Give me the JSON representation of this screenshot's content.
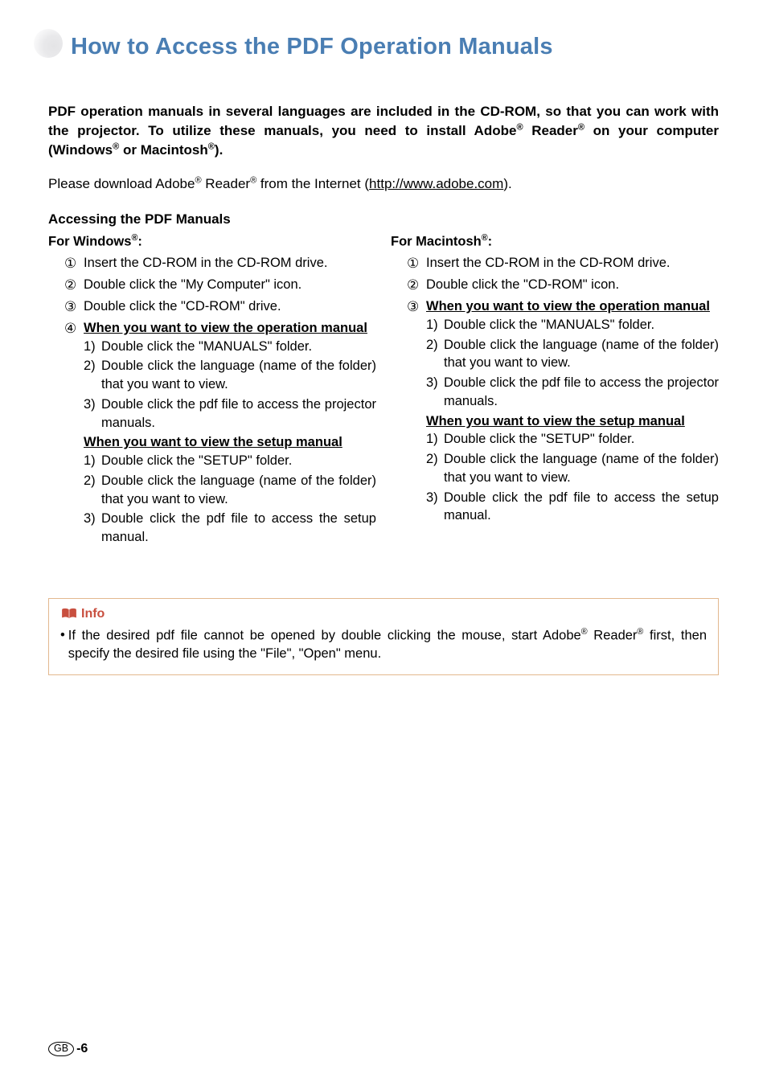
{
  "title": "How to Access the PDF Operation Manuals",
  "intro_bold_1": "PDF operation manuals in several languages are included in the CD-ROM, so that you can work with the projector. To utilize these manuals, you need to install Adobe",
  "intro_bold_sup1": "®",
  "intro_bold_2": " Reader",
  "intro_bold_sup2": "®",
  "intro_bold_3": " on your computer (Windows",
  "intro_bold_sup3": "®",
  "intro_bold_4": " or Macintosh",
  "intro_bold_sup4": "®",
  "intro_bold_5": ").",
  "intro_plain_1": "Please download Adobe",
  "intro_plain_sup1": "®",
  "intro_plain_2": " Reader",
  "intro_plain_sup2": "®",
  "intro_plain_3": " from the Internet (",
  "intro_url": "http://www.adobe.com",
  "intro_plain_4": ").",
  "accessing_title": "Accessing the PDF Manuals",
  "win": {
    "platform": "For Windows",
    "platform_sup": "®",
    "platform_colon": ":",
    "steps": {
      "c1": "①",
      "s1": "Insert the CD-ROM in the CD-ROM drive.",
      "c2": "②",
      "s2": "Double click the \"My Computer\" icon.",
      "c3": "③",
      "s3": "Double click the \"CD-ROM\" drive.",
      "c4": "④",
      "s4_heading_op": "When you want to view the operation manual",
      "s4_op_1n": "1)",
      "s4_op_1": "Double click the \"MANUALS\" folder.",
      "s4_op_2n": "2)",
      "s4_op_2": "Double click the language (name of the folder) that you want to view.",
      "s4_op_3n": "3)",
      "s4_op_3": "Double click the pdf file to access the projector manuals.",
      "s4_heading_setup": "When you want to view the setup manual",
      "s4_su_1n": "1)",
      "s4_su_1": "Double click the \"SETUP\" folder.",
      "s4_su_2n": "2)",
      "s4_su_2": "Double click the language (name of the folder) that you want to view.",
      "s4_su_3n": "3)",
      "s4_su_3": "Double click the pdf file to access the setup manual."
    }
  },
  "mac": {
    "platform": "For Macintosh",
    "platform_sup": "®",
    "platform_colon": ":",
    "steps": {
      "c1": "①",
      "s1": "Insert the CD-ROM in the CD-ROM drive.",
      "c2": "②",
      "s2": "Double click the \"CD-ROM\" icon.",
      "c3": "③",
      "s3_heading_op": "When you want to view the operation manual",
      "s3_op_1n": "1)",
      "s3_op_1": "Double click the \"MANUALS\" folder.",
      "s3_op_2n": "2)",
      "s3_op_2": "Double click the language (name of the folder) that you want to view.",
      "s3_op_3n": "3)",
      "s3_op_3": "Double click the pdf file to access the projector manuals.",
      "s3_heading_setup": "When you want to view the setup manual",
      "s3_su_1n": "1)",
      "s3_su_1": "Double click the \"SETUP\" folder.",
      "s3_su_2n": "2)",
      "s3_su_2": "Double click the language (name of the folder) that you want to view.",
      "s3_su_3n": "3)",
      "s3_su_3": "Double click the pdf file to access the setup manual."
    }
  },
  "info": {
    "label": "Info",
    "bullet": "•",
    "text_1": "If the desired pdf file cannot be opened by double clicking the mouse, start Adobe",
    "sup1": "®",
    "text_2": " Reader",
    "sup2": "®",
    "text_3": " first, then specify the desired file using the \"File\", \"Open\" menu."
  },
  "page": {
    "region": "GB",
    "num": "-6"
  }
}
